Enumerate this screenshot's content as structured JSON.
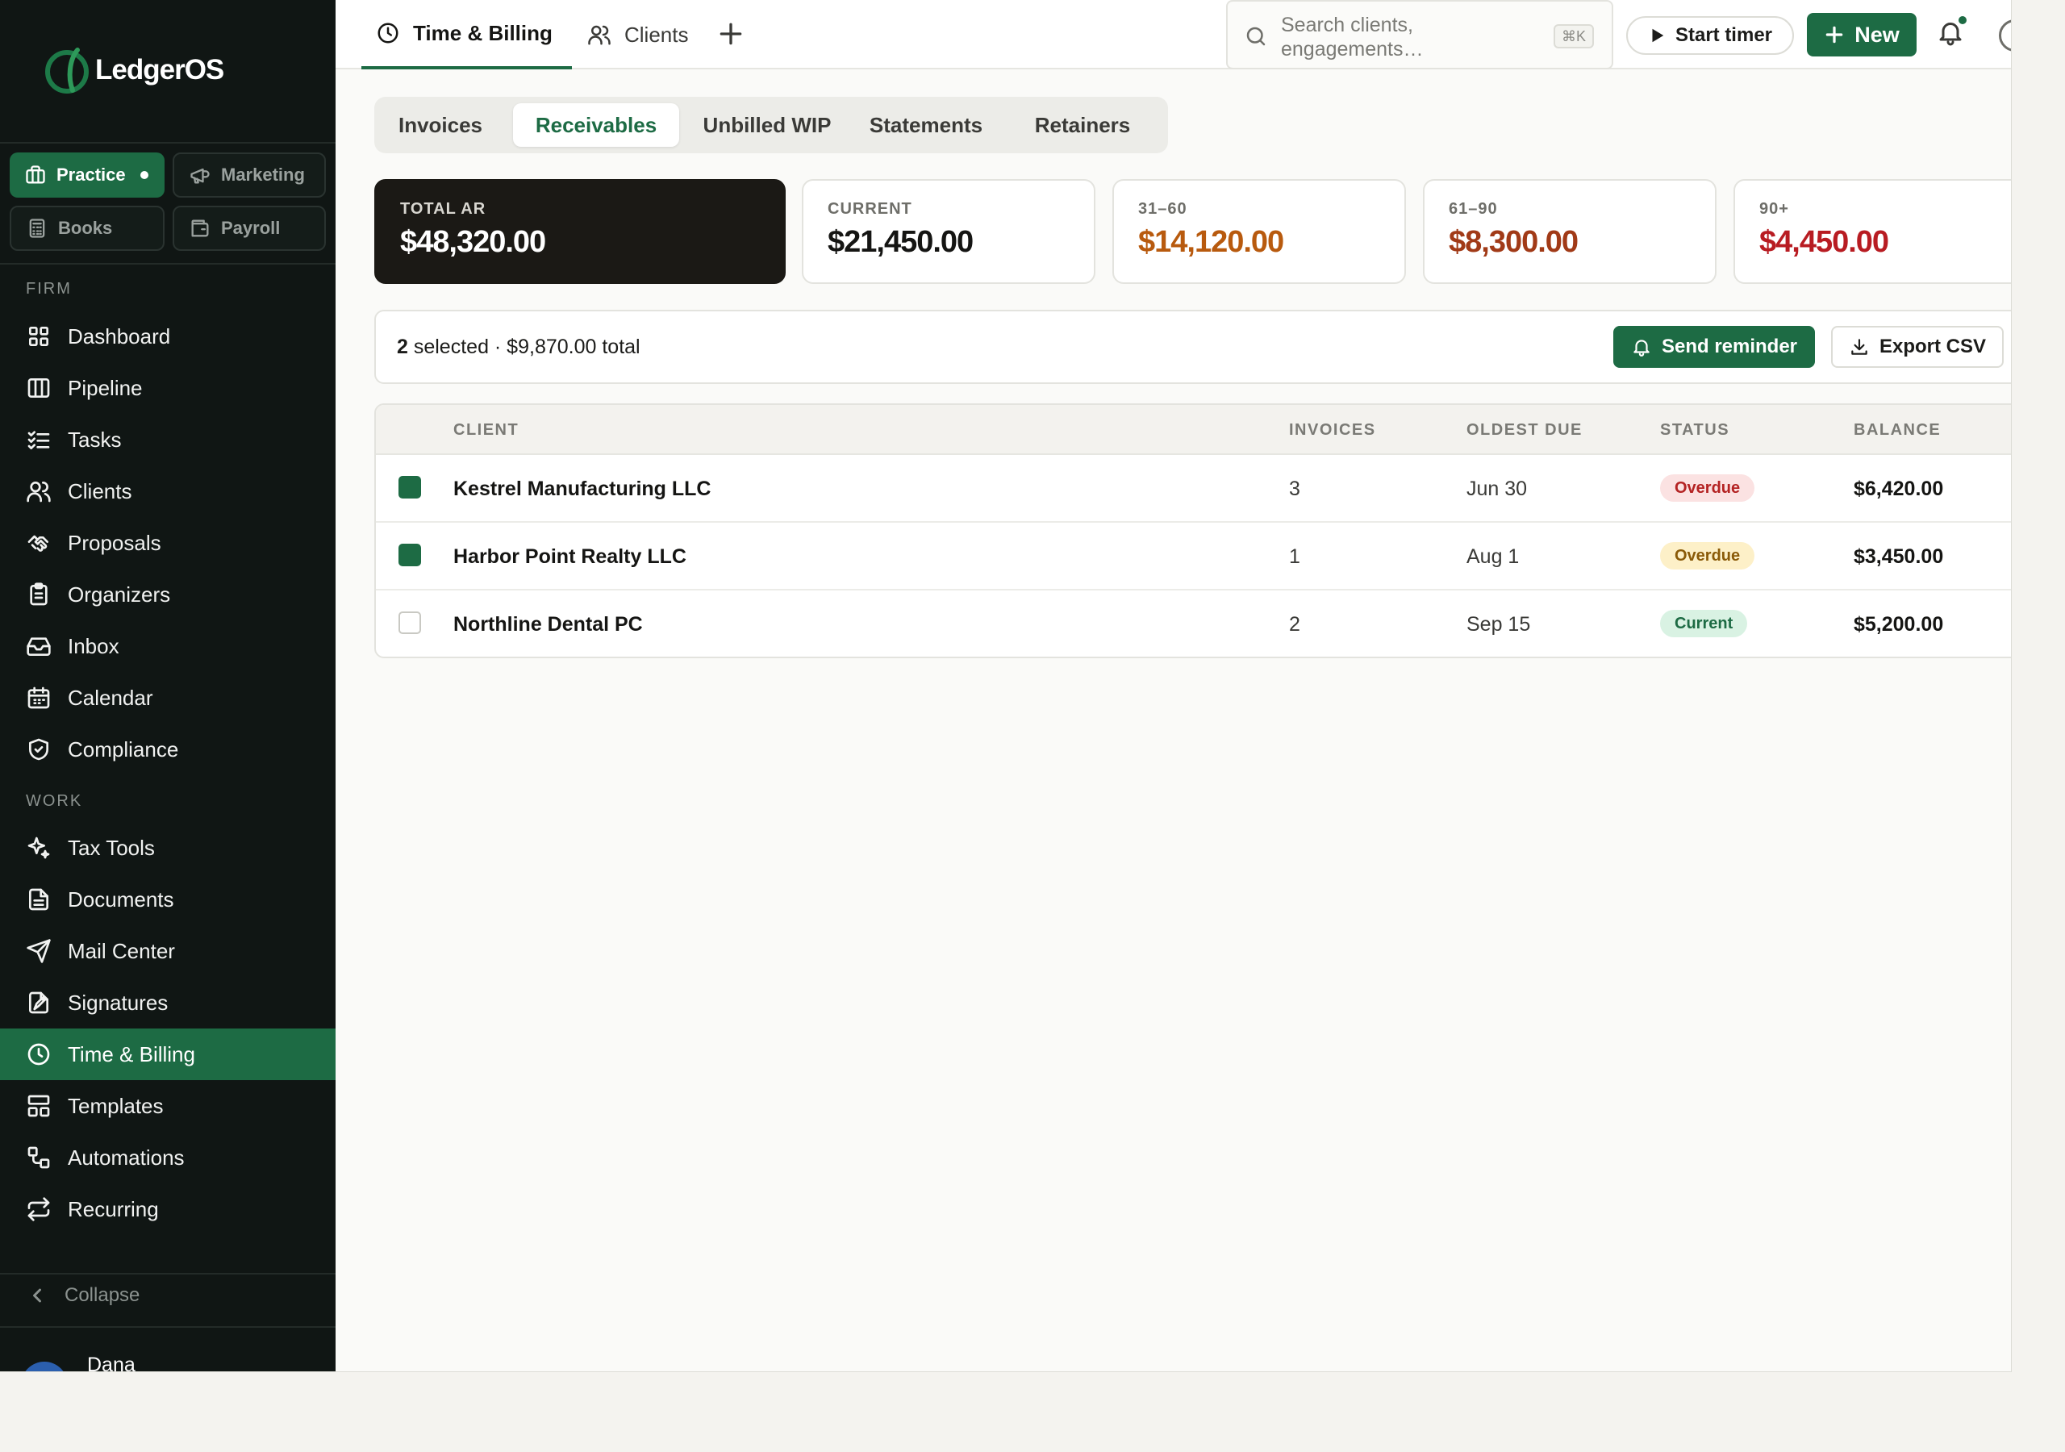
{
  "brand": {
    "name": "LedgerOS"
  },
  "modules": [
    {
      "label": "Practice",
      "icon": "briefcase-icon",
      "active": true
    },
    {
      "label": "Marketing",
      "icon": "megaphone-icon",
      "active": false
    },
    {
      "label": "Books",
      "icon": "calculator-icon",
      "active": false
    },
    {
      "label": "Payroll",
      "icon": "wallet-icon",
      "active": false
    }
  ],
  "sections": {
    "firm": "FIRM",
    "work": "WORK"
  },
  "nav_firm": [
    {
      "label": "Dashboard",
      "icon": "dashboard-icon"
    },
    {
      "label": "Pipeline",
      "icon": "columns-icon"
    },
    {
      "label": "Tasks",
      "icon": "checklist-icon"
    },
    {
      "label": "Clients",
      "icon": "users-icon"
    },
    {
      "label": "Proposals",
      "icon": "handshake-icon"
    },
    {
      "label": "Organizers",
      "icon": "clipboard-icon"
    },
    {
      "label": "Inbox",
      "icon": "inbox-icon"
    },
    {
      "label": "Calendar",
      "icon": "calendar-icon"
    },
    {
      "label": "Compliance",
      "icon": "shield-icon"
    }
  ],
  "nav_work": [
    {
      "label": "Tax Tools",
      "icon": "sparkles-icon"
    },
    {
      "label": "Documents",
      "icon": "document-icon"
    },
    {
      "label": "Mail Center",
      "icon": "send-icon"
    },
    {
      "label": "Signatures",
      "icon": "signature-icon"
    },
    {
      "label": "Time & Billing",
      "icon": "clock-icon",
      "active": true
    },
    {
      "label": "Templates",
      "icon": "layout-icon"
    },
    {
      "label": "Automations",
      "icon": "workflow-icon"
    },
    {
      "label": "Recurring",
      "icon": "repeat-icon"
    }
  ],
  "sidebar_footer": {
    "collapse": "Collapse",
    "user_name": "Dana"
  },
  "topbar": {
    "tabs": [
      {
        "label": "Time & Billing",
        "icon": "clock-icon",
        "active": true
      },
      {
        "label": "Clients",
        "icon": "users-icon",
        "active": false
      }
    ],
    "search_placeholder": "Search clients, engagements…",
    "search_shortcut": "⌘K",
    "start_timer": "Start timer",
    "new_label": "New"
  },
  "subtabs": [
    {
      "label": "Invoices",
      "active": false
    },
    {
      "label": "Receivables",
      "active": true
    },
    {
      "label": "Unbilled WIP",
      "active": false
    },
    {
      "label": "Statements",
      "active": false
    },
    {
      "label": "Retainers",
      "active": false
    }
  ],
  "stats": [
    {
      "label": "TOTAL AR",
      "value": "$48,320.00",
      "color": "#ffffff"
    },
    {
      "label": "CURRENT",
      "value": "$21,450.00",
      "color": "#151513"
    },
    {
      "label": "31–60",
      "value": "$14,120.00",
      "color": "#b85a0e"
    },
    {
      "label": "61–90",
      "value": "$8,300.00",
      "color": "#a13a17"
    },
    {
      "label": "90+",
      "value": "$4,450.00",
      "color": "#b81c22"
    }
  ],
  "selection": {
    "count": "2",
    "rest": " selected · $9,870.00 total",
    "send_reminder": "Send reminder",
    "export_csv": "Export CSV"
  },
  "table": {
    "headers": {
      "client": "CLIENT",
      "invoices": "INVOICES",
      "oldest_due": "OLDEST DUE",
      "status": "STATUS",
      "balance": "BALANCE"
    },
    "rows": [
      {
        "selected": true,
        "client": "Kestrel Manufacturing LLC",
        "invoices": "3",
        "oldest_due": "Jun 30",
        "status": "Overdue",
        "status_tone": "overdue-r",
        "balance": "$6,420.00"
      },
      {
        "selected": true,
        "client": "Harbor Point Realty LLC",
        "invoices": "1",
        "oldest_due": "Aug 1",
        "status": "Overdue",
        "status_tone": "overdue-y",
        "balance": "$3,450.00"
      },
      {
        "selected": false,
        "client": "Northline Dental PC",
        "invoices": "2",
        "oldest_due": "Sep 15",
        "status": "Current",
        "status_tone": "current",
        "balance": "$5,200.00"
      }
    ]
  }
}
